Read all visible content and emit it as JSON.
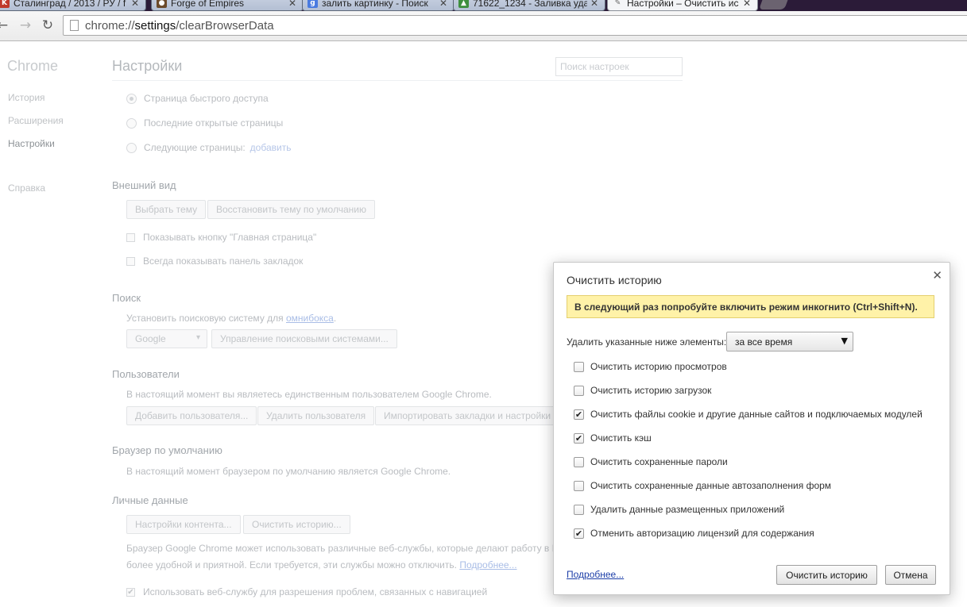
{
  "tabs": [
    {
      "title": "Сталинград / 2013 / РУ / f",
      "icon": "kp-favicon-icon",
      "icon_color": "#c0392b",
      "icon_glyph": "K"
    },
    {
      "title": "Forge of Empires",
      "icon": "forge-of-empires-favicon-icon",
      "icon_color": "#6b4a2a",
      "icon_glyph": "●"
    },
    {
      "title": "залить картинку - Поиск",
      "icon": "google-favicon-icon",
      "icon_color": "#4a7be0",
      "icon_glyph": "g"
    },
    {
      "title": "71622_1234 - Заливка уда",
      "icon": "image-host-favicon-icon",
      "icon_color": "#3e8f3e",
      "icon_glyph": "▲"
    },
    {
      "title": "Настройки – Очистить ис",
      "icon": "wrench-favicon-icon",
      "icon_color": "#7a7a7a",
      "icon_glyph": "✎"
    }
  ],
  "toolbar": {
    "url_prefix": "chrome://",
    "url_host": "settings",
    "url_path": "/clearBrowserData"
  },
  "sidebar": {
    "title": "Chrome",
    "items": [
      {
        "label": "История"
      },
      {
        "label": "Расширения"
      },
      {
        "label": "Настройки"
      },
      {
        "label": "Справка"
      }
    ]
  },
  "settings": {
    "title": "Настройки",
    "search_placeholder": "Поиск настроек",
    "startup": {
      "options": [
        "Страница быстрого доступа",
        "Последние открытые страницы",
        "Следующие страницы:"
      ],
      "add_link": "добавить"
    },
    "appearance": {
      "title": "Внешний вид",
      "choose_theme": "Выбрать тему",
      "reset_theme": "Восстановить тему по умолчанию",
      "show_home": "Показывать кнопку \"Главная страница\"",
      "show_bookmarks": "Всегда показывать панель закладок"
    },
    "search": {
      "title": "Поиск",
      "desc": "Установить поисковую систему для",
      "omnibox_link": "омнибокса",
      "desc_end": ".",
      "engine": "Google",
      "manage": "Управление поисковыми системами..."
    },
    "users": {
      "title": "Пользователи",
      "desc": "В настоящий момент вы являетесь единственным пользователем Google Chrome.",
      "add": "Добавить пользователя...",
      "remove": "Удалить пользователя",
      "import": "Импортировать закладки и настройки"
    },
    "default_browser": {
      "title": "Браузер по умолчанию",
      "desc": "В настоящий момент браузером по умолчанию является Google Chrome."
    },
    "privacy": {
      "title": "Личные данные",
      "content_settings": "Настройки контента...",
      "clear_history": "Очистить историю...",
      "desc_line1": "Браузер Google Chrome может использовать различные веб-службы, которые делают работу в I",
      "desc_line2": "более удобной и приятной. Если требуется, эти службы можно отключить.",
      "more_link": "Подробнее...",
      "nav_error": "Использовать веб-службу для разрешения проблем, связанных с навигацией"
    }
  },
  "dialog": {
    "title": "Очистить историю",
    "tip": "В следующий раз попробуйте включить режим инкогнито (Ctrl+Shift+N).",
    "range_label": "Удалить указанные ниже элементы:",
    "range_value": "за все время",
    "options": [
      {
        "label": "Очистить историю просмотров",
        "checked": false
      },
      {
        "label": "Очистить историю загрузок",
        "checked": false
      },
      {
        "label": "Очистить файлы cookie и другие данные сайтов и подключаемых модулей",
        "checked": true
      },
      {
        "label": "Очистить кэш",
        "checked": true
      },
      {
        "label": "Очистить сохраненные пароли",
        "checked": false
      },
      {
        "label": "Очистить сохраненные данные автозаполнения форм",
        "checked": false
      },
      {
        "label": "Удалить данные размещенных приложений",
        "checked": false
      },
      {
        "label": "Отменить авторизацию лицензий для содержания",
        "checked": true
      }
    ],
    "more_link": "Подробнее...",
    "clear_button": "Очистить историю",
    "cancel_button": "Отмена"
  }
}
